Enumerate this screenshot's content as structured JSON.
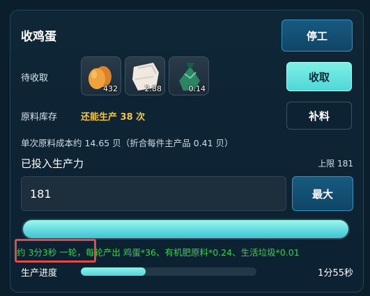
{
  "panel": {
    "title": "收鸡蛋",
    "stop_button": "停工"
  },
  "pending": {
    "label": "待收取",
    "items": [
      {
        "icon": "egg-icon",
        "count": "432"
      },
      {
        "icon": "paper-scrap-icon",
        "count": "2.88"
      },
      {
        "icon": "green-bag-icon",
        "count": "0.14"
      }
    ],
    "collect_button": "收取"
  },
  "stock": {
    "label": "原料库存",
    "value": "还能生产 38 次",
    "refill_button": "补料"
  },
  "cost_text": "单次原料成本约 14.65 贝（折合每件主产品 0.41 贝）",
  "labor": {
    "label": "已投入生产力",
    "limit": "上限 181",
    "input_value": "181",
    "max_button": "最大",
    "slider_fraction": 1.0
  },
  "round_info": "约 3分3秒 一轮，每轮产出 鸡蛋*36、有机肥原料*0.24、生活垃圾*0.01",
  "progress": {
    "label": "生产进度",
    "fraction": 0.37,
    "time_left": "1分55秒"
  },
  "colors": {
    "accent": "#5fd8de",
    "stock_value": "#f2c44c",
    "round_info": "#37d34f",
    "highlight": "#e04a4a"
  }
}
